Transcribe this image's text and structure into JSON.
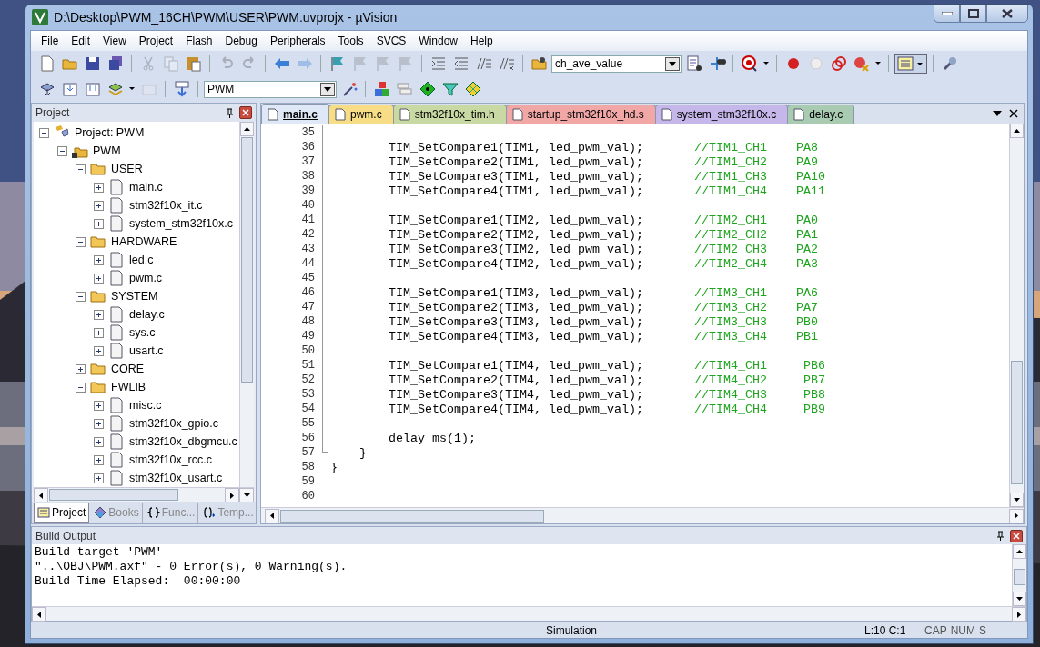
{
  "window": {
    "title": "D:\\Desktop\\PWM_16CH\\PWM\\USER\\PWM.uvprojx - µVision"
  },
  "menu": [
    "File",
    "Edit",
    "View",
    "Project",
    "Flash",
    "Debug",
    "Peripherals",
    "Tools",
    "SVCS",
    "Window",
    "Help"
  ],
  "toolbar_1": {
    "buttons": [
      {
        "disabled": false
      },
      {
        "disabled": false
      },
      {
        "disabled": false
      },
      {
        "disabled": false
      },
      {
        "disabled": true
      },
      {
        "disabled": true
      },
      {
        "disabled": false
      },
      {
        "disabled": true
      },
      {
        "disabled": true
      },
      {
        "disabled": false
      },
      {
        "disabled": true
      },
      {
        "disabled": false
      },
      {
        "disabled": true
      },
      {
        "disabled": true
      },
      {
        "disabled": true
      },
      {
        "disabled": false
      },
      {
        "disabled": false
      },
      {
        "disabled": false
      },
      {
        "disabled": false
      },
      {
        "disabled": false
      }
    ],
    "find_combo": "ch_ave_value"
  },
  "toolbar_2": {
    "target_combo": "PWM"
  },
  "project_panel": {
    "title": "Project",
    "tree": [
      {
        "label": "Project: PWM",
        "kind": "project",
        "expanded": true,
        "children": [
          {
            "label": "PWM",
            "kind": "target",
            "expanded": true,
            "children": [
              {
                "label": "USER",
                "kind": "folder",
                "expanded": true,
                "children": [
                  {
                    "label": "main.c",
                    "kind": "file",
                    "expanded": false
                  },
                  {
                    "label": "stm32f10x_it.c",
                    "kind": "file",
                    "expanded": false
                  },
                  {
                    "label": "system_stm32f10x.c",
                    "kind": "file",
                    "expanded": false
                  }
                ]
              },
              {
                "label": "HARDWARE",
                "kind": "folder",
                "expanded": true,
                "children": [
                  {
                    "label": "led.c",
                    "kind": "file",
                    "expanded": false
                  },
                  {
                    "label": "pwm.c",
                    "kind": "file",
                    "expanded": false
                  }
                ]
              },
              {
                "label": "SYSTEM",
                "kind": "folder",
                "expanded": true,
                "children": [
                  {
                    "label": "delay.c",
                    "kind": "file",
                    "expanded": false
                  },
                  {
                    "label": "sys.c",
                    "kind": "file",
                    "expanded": false
                  },
                  {
                    "label": "usart.c",
                    "kind": "file",
                    "expanded": false
                  }
                ]
              },
              {
                "label": "CORE",
                "kind": "folder",
                "expanded": false
              },
              {
                "label": "FWLIB",
                "kind": "folder",
                "expanded": true,
                "children": [
                  {
                    "label": "misc.c",
                    "kind": "file",
                    "expanded": false
                  },
                  {
                    "label": "stm32f10x_gpio.c",
                    "kind": "file",
                    "expanded": false
                  },
                  {
                    "label": "stm32f10x_dbgmcu.c",
                    "kind": "file",
                    "expanded": false
                  },
                  {
                    "label": "stm32f10x_rcc.c",
                    "kind": "file",
                    "expanded": false
                  },
                  {
                    "label": "stm32f10x_usart.c",
                    "kind": "file",
                    "expanded": false
                  }
                ]
              }
            ]
          }
        ]
      }
    ],
    "tabs": [
      {
        "label": "Project",
        "selected": true
      },
      {
        "label": "Books",
        "selected": false
      },
      {
        "label": "Func...",
        "selected": false
      },
      {
        "label": "Temp...",
        "selected": false
      }
    ]
  },
  "editor": {
    "tabs": [
      {
        "label": "main.c",
        "selected": true,
        "color": "#dfe8f7"
      },
      {
        "label": "pwm.c",
        "selected": false,
        "color": "#f7de86"
      },
      {
        "label": "stm32f10x_tim.h",
        "selected": false,
        "color": "#c9d9a3"
      },
      {
        "label": "startup_stm32f10x_hd.s",
        "selected": false,
        "color": "#f2a7a7"
      },
      {
        "label": "system_stm32f10x.c",
        "selected": false,
        "color": "#c6b7ea"
      },
      {
        "label": "delay.c",
        "selected": false,
        "color": "#a9cbb2"
      }
    ],
    "lines": [
      {
        "number": "35"
      },
      {
        "number": "36",
        "code": "        TIM_SetCompare1(TIM1, led_pwm_val);       ",
        "comment": "//TIM1_CH1    PA8"
      },
      {
        "number": "37",
        "code": "        TIM_SetCompare2(TIM1, led_pwm_val);       ",
        "comment": "//TIM1_CH2    PA9"
      },
      {
        "number": "38",
        "code": "        TIM_SetCompare3(TIM1, led_pwm_val);       ",
        "comment": "//TIM1_CH3    PA10"
      },
      {
        "number": "39",
        "code": "        TIM_SetCompare4(TIM1, led_pwm_val);       ",
        "comment": "//TIM1_CH4    PA11"
      },
      {
        "number": "40"
      },
      {
        "number": "41",
        "code": "        TIM_SetCompare1(TIM2, led_pwm_val);       ",
        "comment": "//TIM2_CH1    PA0"
      },
      {
        "number": "42",
        "code": "        TIM_SetCompare2(TIM2, led_pwm_val);       ",
        "comment": "//TIM2_CH2    PA1"
      },
      {
        "number": "43",
        "code": "        TIM_SetCompare3(TIM2, led_pwm_val);       ",
        "comment": "//TIM2_CH3    PA2"
      },
      {
        "number": "44",
        "code": "        TIM_SetCompare4(TIM2, led_pwm_val);       ",
        "comment": "//TIM2_CH4    PA3"
      },
      {
        "number": "45"
      },
      {
        "number": "46",
        "code": "        TIM_SetCompare1(TIM3, led_pwm_val);       ",
        "comment": "//TIM3_CH1    PA6"
      },
      {
        "number": "47",
        "code": "        TIM_SetCompare2(TIM3, led_pwm_val);       ",
        "comment": "//TIM3_CH2    PA7"
      },
      {
        "number": "48",
        "code": "        TIM_SetCompare3(TIM3, led_pwm_val);       ",
        "comment": "//TIM3_CH3    PB0"
      },
      {
        "number": "49",
        "code": "        TIM_SetCompare4(TIM3, led_pwm_val);       ",
        "comment": "//TIM3_CH4    PB1"
      },
      {
        "number": "50"
      },
      {
        "number": "51",
        "code": "        TIM_SetCompare1(TIM4, led_pwm_val);       ",
        "comment": "//TIM4_CH1     PB6"
      },
      {
        "number": "52",
        "code": "        TIM_SetCompare2(TIM4, led_pwm_val);       ",
        "comment": "//TIM4_CH2     PB7"
      },
      {
        "number": "53",
        "code": "        TIM_SetCompare3(TIM4, led_pwm_val);       ",
        "comment": "//TIM4_CH3     PB8"
      },
      {
        "number": "54",
        "code": "        TIM_SetCompare4(TIM4, led_pwm_val);       ",
        "comment": "//TIM4_CH4     PB9"
      },
      {
        "number": "55"
      },
      {
        "number": "56",
        "code": "        delay_ms(1);"
      },
      {
        "number": "57",
        "code": "    }"
      },
      {
        "number": "58",
        "code": "}"
      },
      {
        "number": "59"
      },
      {
        "number": "60"
      }
    ]
  },
  "build_output": {
    "title": "Build Output",
    "lines": [
      "Build target 'PWM'",
      "\"..\\OBJ\\PWM.axf\" - 0 Error(s), 0 Warning(s).",
      "Build Time Elapsed:  00:00:00"
    ]
  },
  "status_bar": {
    "mode": "Simulation",
    "position": "L:10 C:1",
    "indicators": [
      "CAP",
      "NUM",
      "S"
    ]
  }
}
